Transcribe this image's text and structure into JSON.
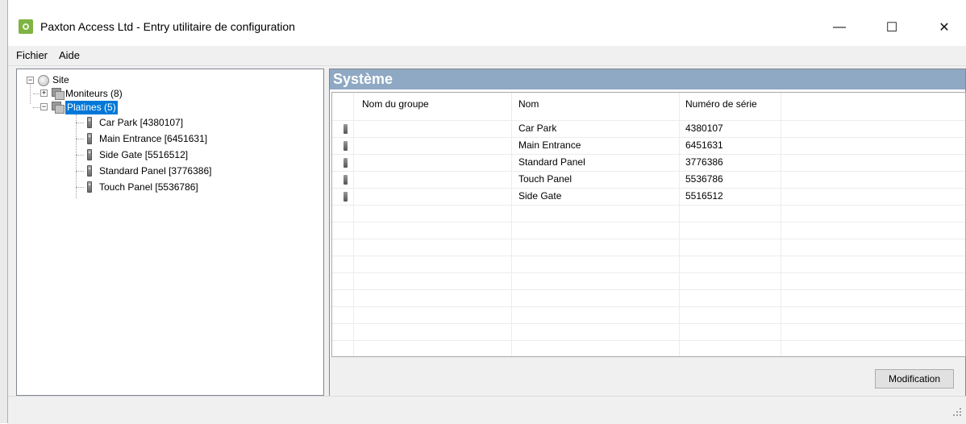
{
  "window": {
    "title": "Paxton Access Ltd - Entry utilitaire de configuration",
    "minimize_glyph": "—",
    "maximize_glyph": "☐",
    "close_glyph": "✕"
  },
  "menu": {
    "items": [
      "Fichier",
      "Aide"
    ]
  },
  "tree": {
    "site": "Site",
    "monitors": "Moniteurs (8)",
    "panels": "Platines (5)",
    "panel_items": [
      "Car Park [4380107]",
      "Main Entrance [6451631]",
      "Side Gate [5516512]",
      "Standard Panel [3776386]",
      "Touch Panel [5536786]"
    ],
    "expander_collapsed": "+",
    "expander_expanded": "−"
  },
  "system": {
    "header": "Système",
    "columns": [
      "Nom du groupe",
      "Nom",
      "Numéro de série"
    ],
    "rows": [
      {
        "group": "",
        "name": "Car Park",
        "serial": "4380107"
      },
      {
        "group": "",
        "name": "Main Entrance",
        "serial": "6451631"
      },
      {
        "group": "",
        "name": "Standard Panel",
        "serial": "3776386"
      },
      {
        "group": "",
        "name": "Touch Panel",
        "serial": "5536786"
      },
      {
        "group": "",
        "name": "Side Gate",
        "serial": "5516512"
      }
    ],
    "modify_button": "Modification"
  },
  "colors": {
    "accent": "#0078d7",
    "header_bar": "#8fa8c3",
    "app_icon": "#7fb342"
  }
}
